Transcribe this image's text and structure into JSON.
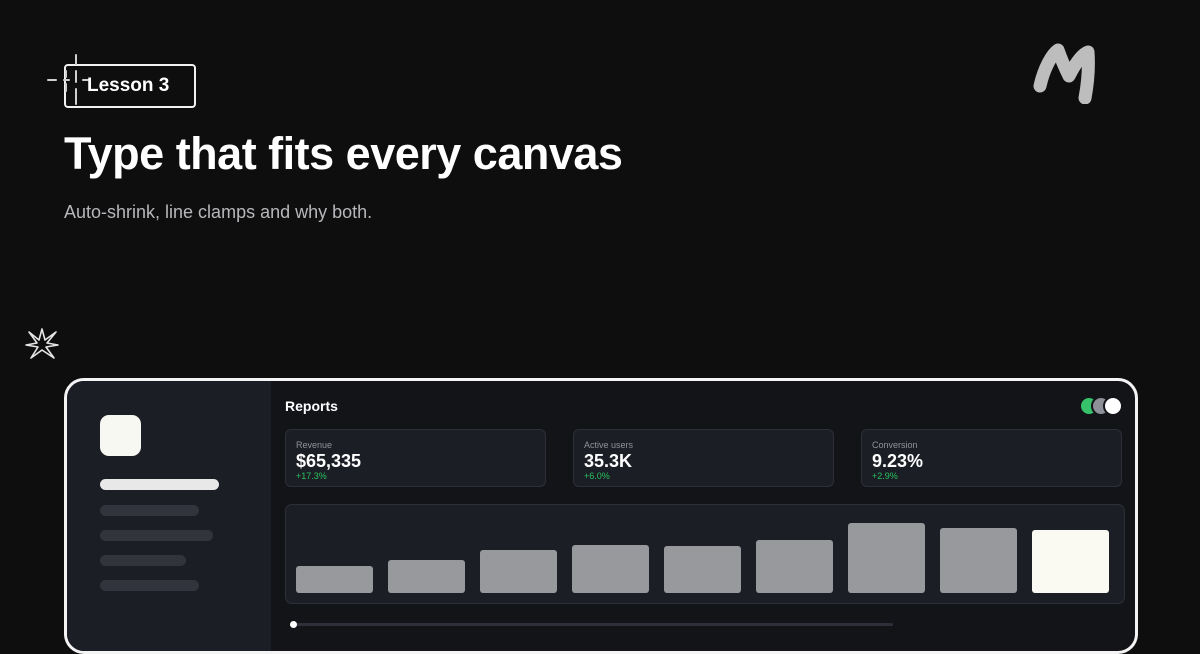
{
  "hero": {
    "badge": "Lesson 3",
    "title": "Type that fits every canvas",
    "subtitle": "Auto-shrink, line clamps and why both."
  },
  "icons": {
    "badge_decoration": "sparkle-icon",
    "brand": "brand-logo-icon",
    "decoration": "starburst-icon"
  },
  "dashboard": {
    "title": "Reports",
    "avatars": [
      "#36c26b",
      "#8e9099",
      "#ffffff"
    ],
    "kpis": [
      {
        "label": "Revenue",
        "value": "$65,335",
        "delta": "+17.3%"
      },
      {
        "label": "Active users",
        "value": "35.3K",
        "delta": "+6.0%"
      },
      {
        "label": "Conversion",
        "value": "9.23%",
        "delta": "+2.9%"
      }
    ],
    "chart_data": {
      "type": "bar",
      "categories": [
        "",
        "",
        "",
        "",
        "",
        "",
        "",
        "",
        ""
      ],
      "values": [
        22,
        27,
        35,
        39,
        38,
        43,
        57,
        53,
        51
      ],
      "highlight_index": 8,
      "colors": {
        "bar": "#98999d",
        "highlight": "#fafaf3"
      }
    }
  },
  "colors": {
    "background": "#0e0e0f",
    "accent_green": "#27c25e"
  }
}
